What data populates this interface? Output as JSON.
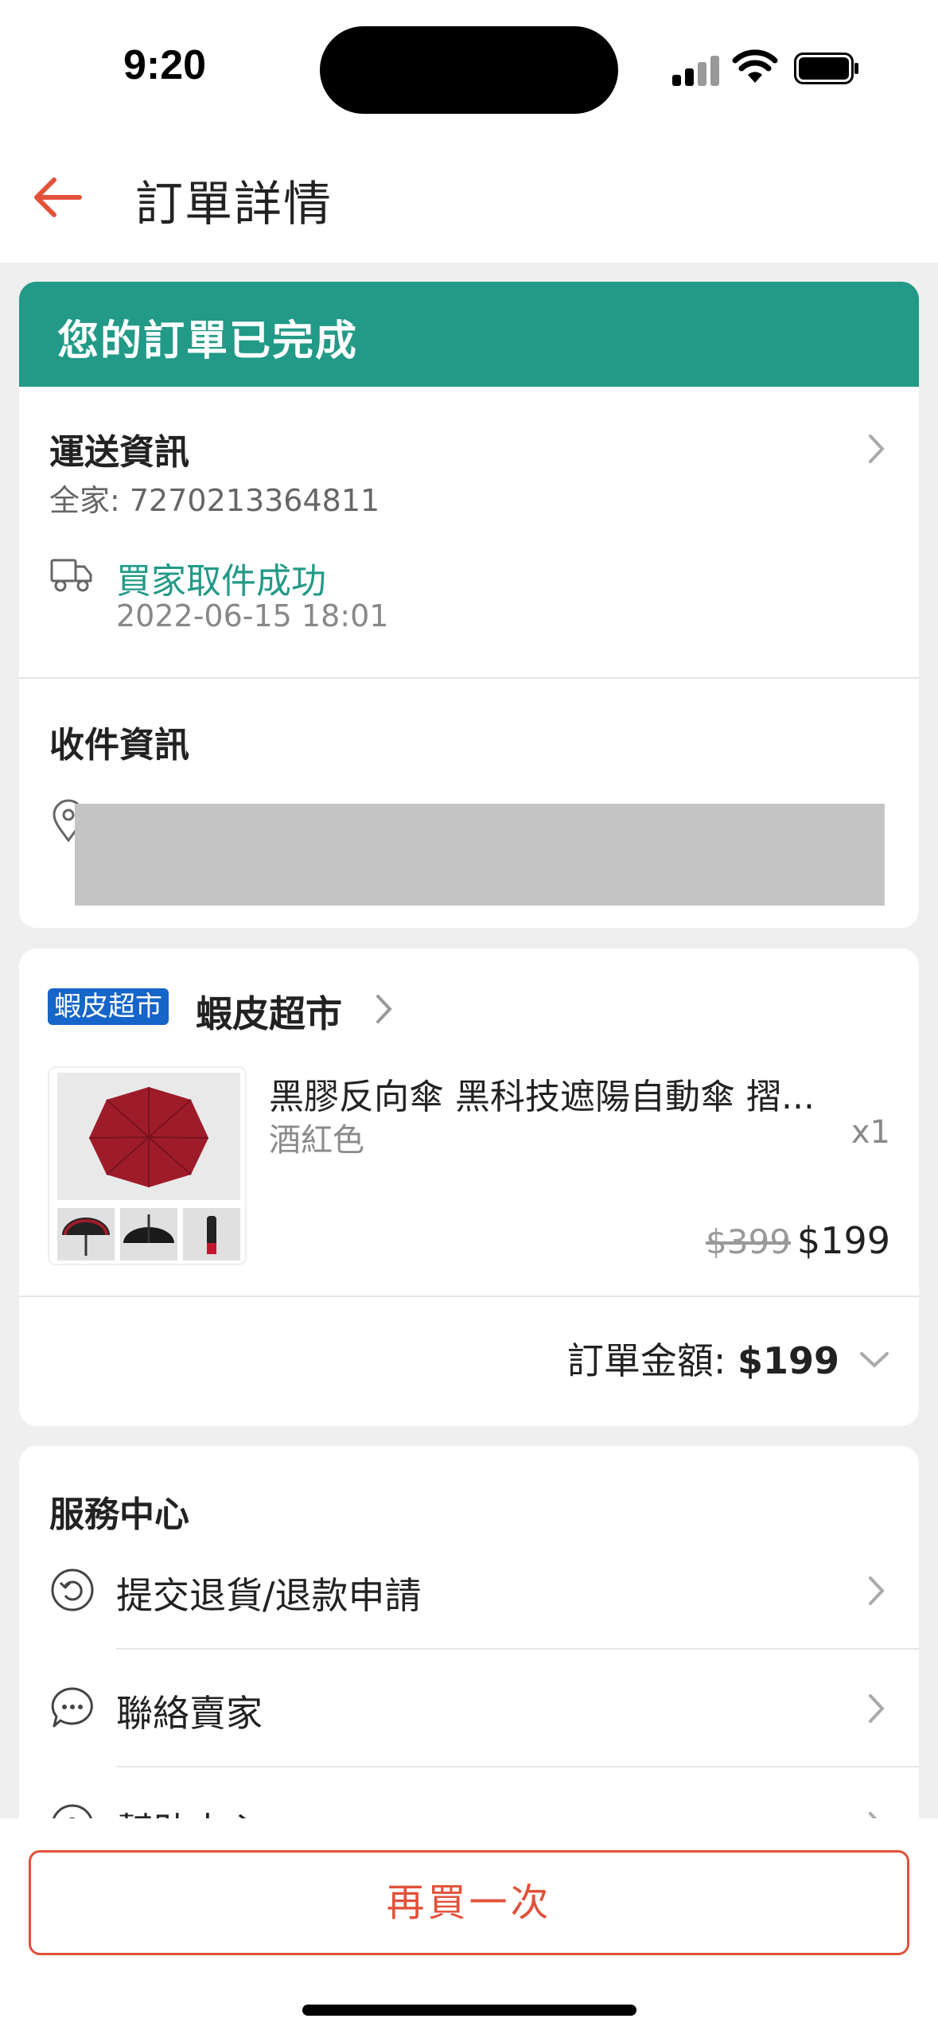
{
  "status_bar": {
    "time": "9:20"
  },
  "header": {
    "title": "訂單詳情"
  },
  "order_status": {
    "banner": "您的訂單已完成"
  },
  "shipping": {
    "title": "運送資訊",
    "tracking": "全家: 7270213364811",
    "event": "買家取件成功",
    "event_time": "2022-06-15 18:01"
  },
  "recipient": {
    "title": "收件資訊"
  },
  "shop": {
    "badge": "蝦皮超市",
    "name": "蝦皮超市"
  },
  "product": {
    "name": "黑膠反向傘 黑科技遮陽自動傘 摺...",
    "variant": "酒紅色",
    "quantity": "x1",
    "original_price": "$399",
    "price": "$199"
  },
  "order_total": {
    "label": "訂單金額: ",
    "amount": "$199"
  },
  "service_center": {
    "title": "服務中心",
    "items": [
      {
        "label": "提交退貨/退款申請",
        "icon": "return-icon"
      },
      {
        "label": "聯絡賣家",
        "icon": "chat-icon"
      },
      {
        "label": "幫助中心",
        "icon": "help-icon"
      }
    ]
  },
  "bottom": {
    "buy_again_label": "再買一次"
  },
  "colors": {
    "accent": "#e2513a",
    "status_green": "#229a87",
    "mall_blue": "#1665c8"
  }
}
